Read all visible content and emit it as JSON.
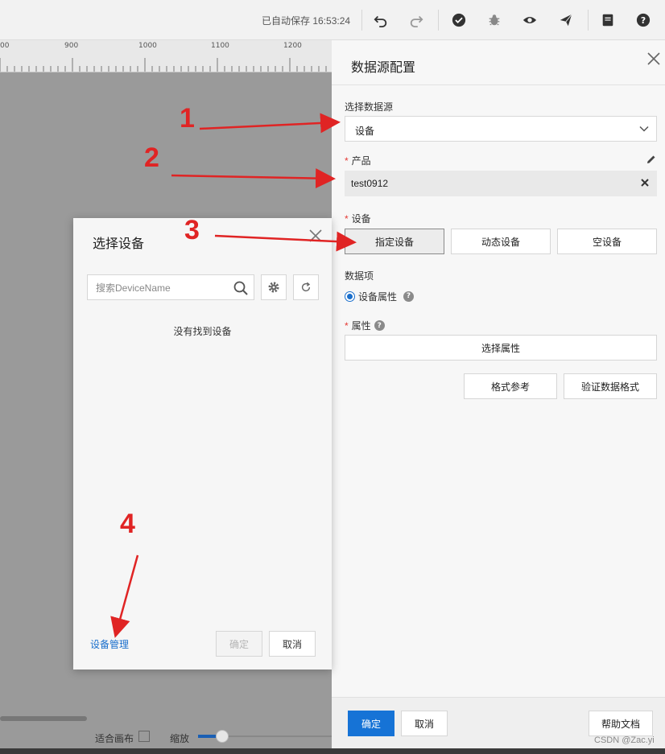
{
  "toolbar": {
    "autosave_text": "已自动保存 16:53:24",
    "icons": [
      "undo-icon",
      "redo-icon",
      "check-circle-icon",
      "bug-icon",
      "eye-icon",
      "send-icon",
      "document-icon",
      "help-icon"
    ]
  },
  "canvas": {
    "ruler_labels": [
      "00",
      "900",
      "1000",
      "1100",
      "1200"
    ],
    "fit_label": "适合画布",
    "zoom_label": "缩放"
  },
  "panel": {
    "title": "数据源配置",
    "source": {
      "label": "选择数据源",
      "value": "设备"
    },
    "product": {
      "label": "产品",
      "value": "test0912"
    },
    "device": {
      "label": "设备",
      "options": [
        "指定设备",
        "动态设备",
        "空设备"
      ],
      "selected": "指定设备"
    },
    "data_item": {
      "label": "数据项",
      "radio_label": "设备属性"
    },
    "attribute": {
      "label": "属性",
      "button": "选择属性"
    },
    "format_ref_button": "格式参考",
    "validate_button": "验证数据格式",
    "footer": {
      "confirm": "确定",
      "cancel": "取消",
      "help": "帮助文档"
    }
  },
  "dialog": {
    "title": "选择设备",
    "search_placeholder": "搜索DeviceName",
    "empty_text": "没有找到设备",
    "manage_link": "设备管理",
    "confirm": "确定",
    "cancel": "取消"
  },
  "annotations": {
    "labels": [
      "1",
      "2",
      "3",
      "4"
    ],
    "color": "#e02424"
  },
  "watermark": "CSDN @Zac.yi",
  "colors": {
    "primary": "#1673d6",
    "link": "#1a6fcc",
    "required": "#e53935"
  }
}
